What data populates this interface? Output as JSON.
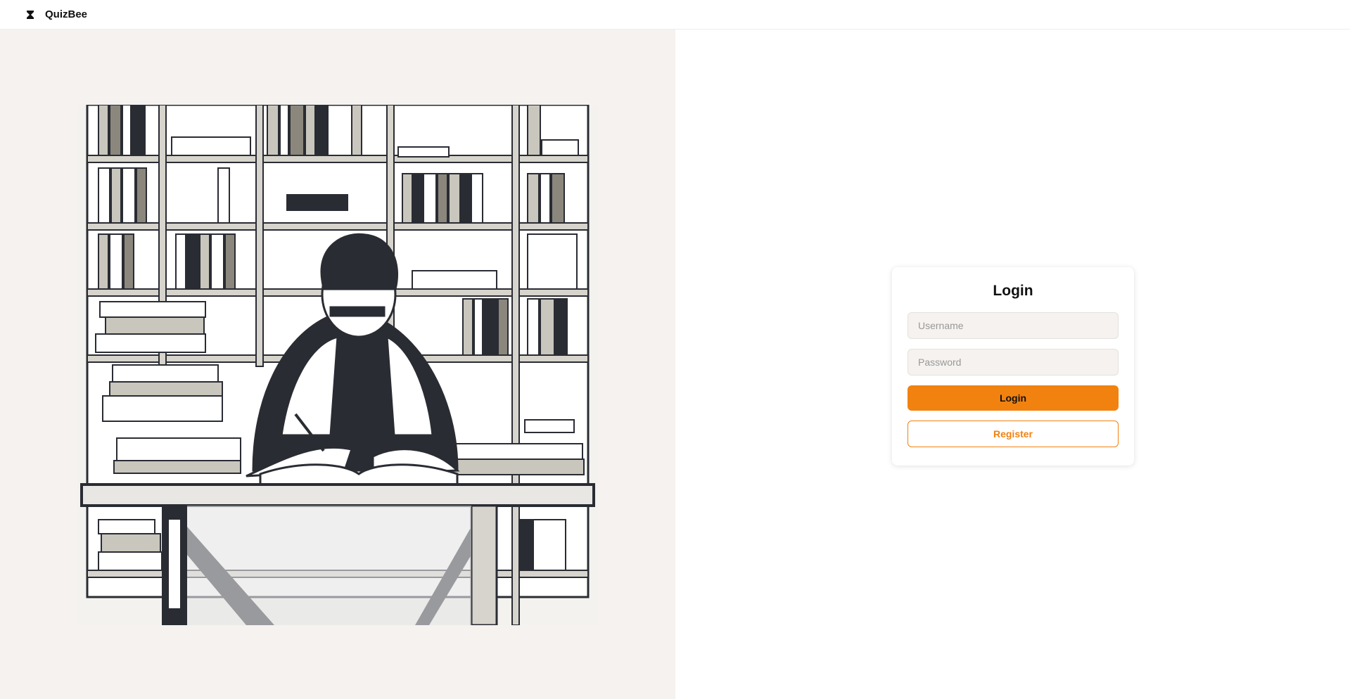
{
  "header": {
    "brand": "QuizBee",
    "logo_icon": "hourglass-icon"
  },
  "illustration": {
    "subject": "student-reading-at-desk-with-bookshelves"
  },
  "login": {
    "title": "Login",
    "username_placeholder": "Username",
    "password_placeholder": "Password",
    "login_label": "Login",
    "register_label": "Register"
  },
  "colors": {
    "accent": "#f2820f",
    "panel_bg": "#f5f2ef",
    "dark": "#2a2c33"
  }
}
